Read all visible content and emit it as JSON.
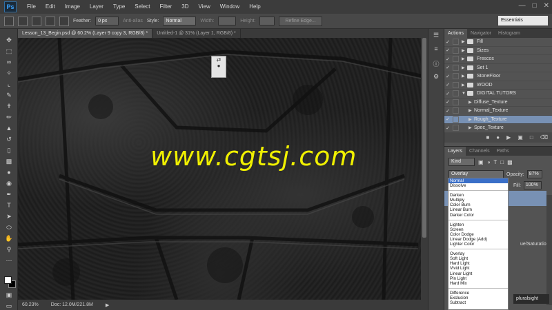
{
  "menubar": {
    "logo": "Ps",
    "items": [
      "File",
      "Edit",
      "Image",
      "Layer",
      "Type",
      "Select",
      "Filter",
      "3D",
      "View",
      "Window",
      "Help"
    ]
  },
  "options": {
    "feather_label": "Feather:",
    "feather_value": "0 px",
    "antialias_label": "Anti-alias",
    "style_label": "Style:",
    "style_value": "Normal",
    "width_label": "Width:",
    "height_label": "Height:",
    "refine_edge": "Refine Edge...",
    "workspace": "Essentials"
  },
  "doc_tabs": [
    "Lesson_13_Begin.psd @ 60.2% (Layer 9 copy 3, RGB/8) *",
    "Untitled-1 @ 31% (Layer 1, RGB/8) *"
  ],
  "status": {
    "zoom": "60.23%",
    "doc": "Doc: 12.0M/221.8M"
  },
  "watermark": "www.cgtsj.com",
  "top_panel": {
    "tabs": [
      "Actions",
      "Navigator",
      "Histogram"
    ],
    "actions": [
      {
        "label": "Fill",
        "kind": "folder",
        "selected": false
      },
      {
        "label": "Sizes",
        "kind": "folder",
        "selected": false
      },
      {
        "label": "Frescos",
        "kind": "folder",
        "selected": false
      },
      {
        "label": "Set 1",
        "kind": "folder",
        "selected": false
      },
      {
        "label": "StoneFloor",
        "kind": "folder",
        "selected": false
      },
      {
        "label": "WOOD",
        "kind": "folder",
        "selected": false
      },
      {
        "label": "DIGITAL TUTORS",
        "kind": "open-folder",
        "selected": false
      },
      {
        "label": "Diffuse_Texture",
        "kind": "action",
        "selected": false
      },
      {
        "label": "Normal_Texture",
        "kind": "action",
        "selected": false
      },
      {
        "label": "Rough_Texture",
        "kind": "action",
        "selected": true
      },
      {
        "label": "Spec_Texture",
        "kind": "action",
        "selected": false
      }
    ]
  },
  "layers_panel": {
    "tabs": [
      "Layers",
      "Channels",
      "Paths"
    ],
    "kind_label": "Kind",
    "blend_mode": "Overlay",
    "opacity_label": "Opacity:",
    "opacity_value": "87%",
    "fill_label": "Fill:",
    "fill_value": "100%",
    "layer_text": "ue/Saturatio...",
    "brand": "pluralsight"
  },
  "blend_dropdown": {
    "groups": [
      [
        "Normal",
        "Dissolve"
      ],
      [
        "Darken",
        "Multiply",
        "Color Burn",
        "Linear Burn",
        "Darker Color"
      ],
      [
        "Lighten",
        "Screen",
        "Color Dodge",
        "Linear Dodge (Add)",
        "Lighter Color"
      ],
      [
        "Overlay",
        "Soft Light",
        "Hard Light",
        "Vivid Light",
        "Linear Light",
        "Pin Light",
        "Hard Mix"
      ],
      [
        "Difference",
        "Exclusion",
        "Subtract"
      ]
    ],
    "highlighted": "Normal"
  },
  "colors": {
    "selection": "#7891b4",
    "dropdown_highlight": "#3a6fc8",
    "watermark": "#f0f000"
  }
}
